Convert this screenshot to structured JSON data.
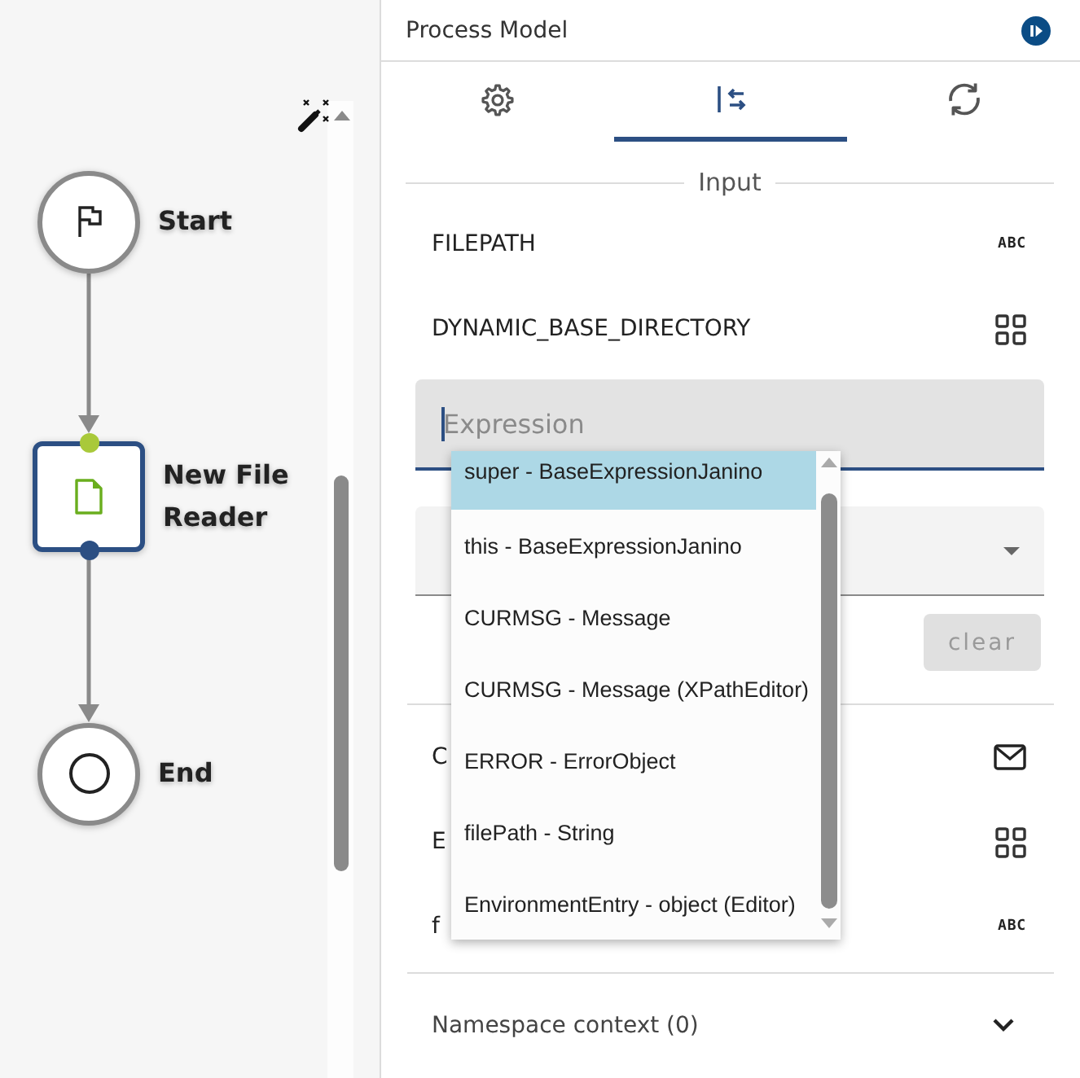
{
  "canvas": {
    "nodes": [
      {
        "kind": "start",
        "label": "Start",
        "selected": false
      },
      {
        "kind": "task",
        "label": "New File Reader",
        "selected": true
      },
      {
        "kind": "end",
        "label": "End",
        "selected": false
      }
    ]
  },
  "panel": {
    "title": "Process Model"
  },
  "tabs": [
    {
      "kind": "settings",
      "selected": false
    },
    {
      "kind": "mapping",
      "selected": true
    },
    {
      "kind": "refresh",
      "selected": false
    }
  ],
  "input_section": {
    "title": "Input",
    "params": [
      {
        "name": "FILEPATH",
        "kind": "string",
        "type_label": "ABC"
      },
      {
        "name": "DYNAMIC_BASE_DIRECTORY",
        "kind": "object"
      }
    ]
  },
  "expression": {
    "placeholder": "Expression",
    "focused": true
  },
  "clear_button": {
    "label": "clear",
    "disabled": true
  },
  "more_params": [
    {
      "name": "C",
      "kind": "message"
    },
    {
      "name": "E",
      "kind": "object"
    },
    {
      "name": "f",
      "kind": "string",
      "type_label": "ABC"
    }
  ],
  "namespace": {
    "label": "Namespace context (0)",
    "expanded": false
  },
  "autocomplete": {
    "items": [
      {
        "label": "super - BaseExpressionJanino",
        "selected": true
      },
      {
        "label": "this - BaseExpressionJanino",
        "selected": false
      },
      {
        "label": "CURMSG - Message",
        "selected": false
      },
      {
        "label": "CURMSG - Message (XPathEditor)",
        "selected": false
      },
      {
        "label": "ERROR - ErrorObject",
        "selected": false
      },
      {
        "label": "filePath - String",
        "selected": false
      },
      {
        "label": "EnvironmentEntry - object (Editor)",
        "selected": false
      }
    ]
  }
}
